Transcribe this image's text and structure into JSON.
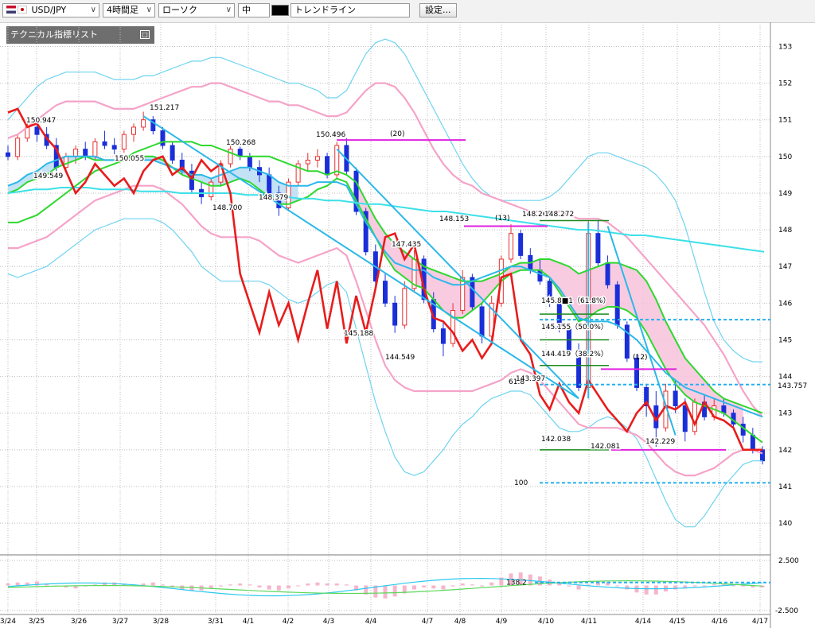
{
  "toolbar": {
    "pair": "USD/JPY",
    "timeframe": "4時間足",
    "chart_type": "ローソク",
    "line_width": "中",
    "tool": "トレンドライン",
    "settings": "設定..."
  },
  "indicator_panel": {
    "title": "テクニカル指標リスト"
  },
  "colors": {
    "candle_up": "#e83030",
    "candle_down": "#1a2fd8",
    "red_line": "#e81c1c",
    "green_line": "#2ed82e",
    "blue_line": "#2bb8e8",
    "cyan_line": "#3ce0e8",
    "bollinger": "#f5a3c8",
    "bollinger_outer": "#6fd3f0",
    "cloud_pink": "#f7c2dc",
    "cloud_blue": "#b9ddf5",
    "magenta": "#e020e0",
    "fib_green": "#1a8a1a",
    "dashed_blue": "#22b0ee"
  },
  "chart_data": {
    "type": "candlestick",
    "instrument": "USD/JPY",
    "y_range": [
      139.2,
      153.4
    ],
    "y_ticks": [
      153,
      152,
      151,
      150,
      149,
      148,
      147,
      146,
      145,
      144,
      143,
      142,
      141,
      140
    ],
    "x_dates": [
      "3/24",
      "3/25",
      "3/26",
      "3/27",
      "3/28",
      "3/31",
      "4/1",
      "4/2",
      "4/3",
      "4/4",
      "4/7",
      "4/8",
      "4/9",
      "4/10",
      "4/11",
      "4/14",
      "4/15",
      "4/16",
      "4/17"
    ],
    "price_labels": [
      {
        "text": "150.947",
        "value": 150.947
      },
      {
        "text": "149.549",
        "value": 149.549
      },
      {
        "text": "150.055",
        "value": 150.055
      },
      {
        "text": "151.217",
        "value": 151.217
      },
      {
        "text": "150.268",
        "value": 150.268
      },
      {
        "text": "148.700",
        "value": 148.7
      },
      {
        "text": "148.379",
        "value": 148.379
      },
      {
        "text": "150.496",
        "value": 150.496
      },
      {
        "text": "147.435",
        "value": 147.435
      },
      {
        "text": "145.188",
        "value": 145.188
      },
      {
        "text": "144.549",
        "value": 144.549
      },
      {
        "text": "148.153",
        "value": 148.153
      },
      {
        "text": "148.268",
        "value": 148.268
      },
      {
        "text": "148.272",
        "value": 148.272
      },
      {
        "text": "143.397",
        "value": 143.397
      },
      {
        "text": "142.038",
        "value": 142.038
      },
      {
        "text": "142.081",
        "value": 142.081
      },
      {
        "text": "142.229",
        "value": 142.229
      }
    ],
    "current_price": "143.757",
    "fib_labels": [
      "145.8■1（61.8%）",
      "145.155（50.0%）",
      "144.419（38.2%）"
    ],
    "fib_side_labels": [
      "61.8",
      "100"
    ],
    "count_labels": [
      "(20)",
      "(13)",
      "(12)"
    ],
    "macd_ticks": [
      "2.500",
      "-2.500"
    ],
    "macd_mid_label": "138.2",
    "candles": [
      [
        150.1,
        150.3,
        149.9,
        150.0
      ],
      [
        150.0,
        150.6,
        149.9,
        150.5
      ],
      [
        150.5,
        150.95,
        150.4,
        150.8
      ],
      [
        150.8,
        150.9,
        150.4,
        150.6
      ],
      [
        150.6,
        150.8,
        150.2,
        150.3
      ],
      [
        150.3,
        150.5,
        149.6,
        149.7
      ],
      [
        149.7,
        150.1,
        149.55,
        150.0
      ],
      [
        150.0,
        150.3,
        149.8,
        150.2
      ],
      [
        150.2,
        150.4,
        149.9,
        150.0
      ],
      [
        150.0,
        150.5,
        149.9,
        150.4
      ],
      [
        150.4,
        150.7,
        150.2,
        150.3
      ],
      [
        150.3,
        150.5,
        150.06,
        150.2
      ],
      [
        150.2,
        150.7,
        150.1,
        150.6
      ],
      [
        150.6,
        150.9,
        150.4,
        150.8
      ],
      [
        150.8,
        151.22,
        150.7,
        151.0
      ],
      [
        151.0,
        151.1,
        150.6,
        150.7
      ],
      [
        150.7,
        150.8,
        150.2,
        150.3
      ],
      [
        150.3,
        150.4,
        149.8,
        149.9
      ],
      [
        149.9,
        150.1,
        149.5,
        149.6
      ],
      [
        149.6,
        149.8,
        149.0,
        149.1
      ],
      [
        149.1,
        149.3,
        148.7,
        148.9
      ],
      [
        148.9,
        149.4,
        148.8,
        149.3
      ],
      [
        149.3,
        149.9,
        149.2,
        149.8
      ],
      [
        149.8,
        150.3,
        149.7,
        150.2
      ],
      [
        150.2,
        150.27,
        149.9,
        150.0
      ],
      [
        150.0,
        150.1,
        149.6,
        149.7
      ],
      [
        149.7,
        149.9,
        149.3,
        149.5
      ],
      [
        149.5,
        149.7,
        148.9,
        149.0
      ],
      [
        149.0,
        149.2,
        148.38,
        148.6
      ],
      [
        148.6,
        149.4,
        148.5,
        149.3
      ],
      [
        149.3,
        149.9,
        149.2,
        149.8
      ],
      [
        149.8,
        150.1,
        149.6,
        149.9
      ],
      [
        149.9,
        150.2,
        149.7,
        150.0
      ],
      [
        150.0,
        150.1,
        149.4,
        149.5
      ],
      [
        149.5,
        150.4,
        149.4,
        150.3
      ],
      [
        150.3,
        150.5,
        149.5,
        149.6
      ],
      [
        149.6,
        149.7,
        148.4,
        148.5
      ],
      [
        148.5,
        148.6,
        147.3,
        147.4
      ],
      [
        147.4,
        147.6,
        146.4,
        146.6
      ],
      [
        146.6,
        146.8,
        145.9,
        146.0
      ],
      [
        146.0,
        146.2,
        145.19,
        145.4
      ],
      [
        145.4,
        146.6,
        145.3,
        146.4
      ],
      [
        146.4,
        147.44,
        146.3,
        147.2
      ],
      [
        147.2,
        147.3,
        146.0,
        146.1
      ],
      [
        146.1,
        146.3,
        145.2,
        145.3
      ],
      [
        145.3,
        145.5,
        144.55,
        144.9
      ],
      [
        144.9,
        146.0,
        144.8,
        145.8
      ],
      [
        145.8,
        146.9,
        145.7,
        146.7
      ],
      [
        146.7,
        146.8,
        145.8,
        145.9
      ],
      [
        145.9,
        146.0,
        144.9,
        145.1
      ],
      [
        145.1,
        146.2,
        145.0,
        146.0
      ],
      [
        146.0,
        147.3,
        145.9,
        147.2
      ],
      [
        147.2,
        148.15,
        147.1,
        147.9
      ],
      [
        147.9,
        148.0,
        147.2,
        147.3
      ],
      [
        147.3,
        147.5,
        146.8,
        146.9
      ],
      [
        146.9,
        147.2,
        146.5,
        146.6
      ],
      [
        146.6,
        146.7,
        145.9,
        146.0
      ],
      [
        146.0,
        146.1,
        145.2,
        145.3
      ],
      [
        145.3,
        145.4,
        144.6,
        144.7
      ],
      [
        144.7,
        144.9,
        143.6,
        143.7
      ],
      [
        143.7,
        148.27,
        143.4,
        147.9
      ],
      [
        147.9,
        148.27,
        147.0,
        147.1
      ],
      [
        147.1,
        147.3,
        146.4,
        146.5
      ],
      [
        146.5,
        146.6,
        145.3,
        145.4
      ],
      [
        145.4,
        145.5,
        144.4,
        144.5
      ],
      [
        144.5,
        144.6,
        143.6,
        143.7
      ],
      [
        143.7,
        143.8,
        142.9,
        143.2
      ],
      [
        143.2,
        143.6,
        142.08,
        142.6
      ],
      [
        142.6,
        143.8,
        142.5,
        143.6
      ],
      [
        143.6,
        143.9,
        143.0,
        143.2
      ],
      [
        143.2,
        143.4,
        142.23,
        142.5
      ],
      [
        142.5,
        143.4,
        142.4,
        143.3
      ],
      [
        143.3,
        143.5,
        142.8,
        142.9
      ],
      [
        142.9,
        143.4,
        142.8,
        143.2
      ],
      [
        143.2,
        143.4,
        142.9,
        143.0
      ],
      [
        143.0,
        143.1,
        142.6,
        142.7
      ],
      [
        142.7,
        142.9,
        142.2,
        142.4
      ],
      [
        142.4,
        142.6,
        141.9,
        142.0
      ],
      [
        142.0,
        142.1,
        141.6,
        141.7
      ]
    ],
    "red_line": [
      151.2,
      151.3,
      150.8,
      150.9,
      150.5,
      150.2,
      149.6,
      149.0,
      149.3,
      149.8,
      149.5,
      149.2,
      149.4,
      149.0,
      149.6,
      149.9,
      150.0,
      149.5,
      149.7,
      149.4,
      149.9,
      149.6,
      149.8,
      149.0,
      146.8,
      146.0,
      145.2,
      146.3,
      145.4,
      146.0,
      145.0,
      146.0,
      146.9,
      145.3,
      146.6,
      144.9,
      146.2,
      145.2,
      146.4,
      147.8,
      147.9,
      147.2,
      147.6,
      146.4,
      145.6,
      145.5,
      145.2,
      144.7,
      145.0,
      144.5,
      144.9,
      146.7,
      146.8,
      145.0,
      144.6,
      143.5,
      143.1,
      143.8,
      143.3,
      143.0,
      143.9,
      143.5,
      143.1,
      142.8,
      142.5,
      143.0,
      143.3,
      142.8,
      143.2,
      143.1,
      143.3,
      142.7,
      143.3,
      142.9,
      142.8,
      142.6,
      142.0,
      142.0,
      142.0
    ],
    "green_fast": [
      149.0,
      149.1,
      149.3,
      149.4,
      149.5,
      149.7,
      149.8,
      149.9,
      150.0,
      149.9,
      149.9,
      149.9,
      149.9,
      150.0,
      150.0,
      150.0,
      149.9,
      149.7,
      149.5,
      149.4,
      149.3,
      149.2,
      149.2,
      149.3,
      149.4,
      149.3,
      149.1,
      148.9,
      148.7,
      148.7,
      148.8,
      148.9,
      149.1,
      149.2,
      149.4,
      149.3,
      148.8,
      148.3,
      147.8,
      147.3,
      146.9,
      146.7,
      146.5,
      146.4,
      146.1,
      145.8,
      145.6,
      145.6,
      145.8,
      146.0,
      146.3,
      146.6,
      146.8,
      146.9,
      146.9,
      146.9,
      146.7,
      146.3,
      145.9,
      145.5,
      145.6,
      145.8,
      145.9,
      145.9,
      145.8,
      145.6,
      145.2,
      144.7,
      144.2,
      143.8,
      143.5,
      143.3,
      143.2,
      143.1,
      143.0,
      142.8,
      142.6,
      142.4,
      142.2
    ],
    "green_slow": [
      148.2,
      148.2,
      148.3,
      148.4,
      148.6,
      148.8,
      149.0,
      149.2,
      149.4,
      149.6,
      149.7,
      149.8,
      149.9,
      150.1,
      150.2,
      150.3,
      150.4,
      150.4,
      150.4,
      150.4,
      150.3,
      150.3,
      150.2,
      150.1,
      150.0,
      150.0,
      150.0,
      150.0,
      149.9,
      149.8,
      149.7,
      149.6,
      149.6,
      149.5,
      149.6,
      149.5,
      149.3,
      148.8,
      148.3,
      147.9,
      147.6,
      147.4,
      147.2,
      147.0,
      146.9,
      146.8,
      146.7,
      146.6,
      146.6,
      146.6,
      146.7,
      146.8,
      147.0,
      147.1,
      147.1,
      147.2,
      147.2,
      147.1,
      147.0,
      146.8,
      146.9,
      147.0,
      147.1,
      147.1,
      147.0,
      146.9,
      146.6,
      146.1,
      145.5,
      145.0,
      144.5,
      144.2,
      143.9,
      143.6,
      143.4,
      143.3,
      143.2,
      143.1,
      143.0
    ],
    "blue_line": [
      149.2,
      149.3,
      149.5,
      149.6,
      149.8,
      149.9,
      150.0,
      150.0,
      150.0,
      150.0,
      149.9,
      149.9,
      149.9,
      149.9,
      149.9,
      149.9,
      149.8,
      149.7,
      149.6,
      149.5,
      149.5,
      149.4,
      149.5,
      149.6,
      149.7,
      149.7,
      149.6,
      149.5,
      149.3,
      149.2,
      149.2,
      149.2,
      149.3,
      149.3,
      149.3,
      149.2,
      148.7,
      148.2,
      147.8,
      147.4,
      147.1,
      147.0,
      146.9,
      146.9,
      146.7,
      146.6,
      146.5,
      146.5,
      146.6,
      146.7,
      146.8,
      146.9,
      147.0,
      147.0,
      146.9,
      146.8,
      146.7,
      146.4,
      146.0,
      145.6,
      145.5,
      145.5,
      145.5,
      145.4,
      145.2,
      145.0,
      144.7,
      144.4,
      144.1,
      143.9,
      143.7,
      143.6,
      143.5,
      143.4,
      143.3,
      143.2,
      143.1,
      143.0,
      142.9
    ],
    "boll_upper": [
      150.5,
      150.6,
      150.8,
      151.0,
      151.2,
      151.4,
      151.5,
      151.5,
      151.5,
      151.5,
      151.4,
      151.3,
      151.3,
      151.3,
      151.4,
      151.5,
      151.6,
      151.7,
      151.8,
      151.9,
      151.9,
      152.0,
      152.0,
      151.9,
      151.8,
      151.7,
      151.6,
      151.5,
      151.5,
      151.4,
      151.4,
      151.3,
      151.2,
      151.1,
      151.1,
      151.2,
      151.5,
      151.8,
      152.0,
      152.0,
      151.9,
      151.6,
      151.2,
      150.7,
      150.2,
      149.8,
      149.5,
      149.3,
      149.2,
      149.0,
      148.9,
      148.8,
      148.7,
      148.6,
      148.5,
      148.5,
      148.5,
      148.5,
      148.4,
      148.3,
      148.3,
      148.3,
      148.2,
      148.0,
      147.8,
      147.5,
      147.2,
      146.9,
      146.6,
      146.3,
      146.0,
      145.7,
      145.4,
      145.0,
      144.6,
      144.1,
      143.6,
      143.2,
      142.9
    ],
    "boll_lower": [
      147.5,
      147.5,
      147.6,
      147.7,
      147.8,
      148.0,
      148.2,
      148.4,
      148.6,
      148.8,
      148.9,
      149.0,
      149.1,
      149.2,
      149.2,
      149.2,
      149.1,
      148.9,
      148.7,
      148.4,
      148.1,
      147.9,
      147.8,
      147.8,
      147.8,
      147.8,
      147.7,
      147.5,
      147.3,
      147.2,
      147.1,
      147.2,
      147.3,
      147.4,
      147.5,
      147.3,
      146.6,
      145.8,
      145.0,
      144.3,
      143.9,
      143.7,
      143.6,
      143.6,
      143.6,
      143.6,
      143.6,
      143.6,
      143.6,
      143.7,
      143.8,
      143.9,
      144.1,
      144.2,
      144.1,
      143.9,
      143.6,
      143.3,
      143.0,
      142.7,
      142.6,
      142.6,
      142.6,
      142.6,
      142.5,
      142.4,
      142.2,
      141.9,
      141.6,
      141.4,
      141.3,
      141.3,
      141.4,
      141.5,
      141.7,
      141.9,
      142.0,
      142.0,
      141.9
    ],
    "boll_outer_upper": [
      151.0,
      151.3,
      151.6,
      151.9,
      152.1,
      152.2,
      152.3,
      152.3,
      152.3,
      152.3,
      152.2,
      152.1,
      152.1,
      152.1,
      152.2,
      152.2,
      152.3,
      152.4,
      152.5,
      152.6,
      152.6,
      152.7,
      152.7,
      152.6,
      152.5,
      152.4,
      152.3,
      152.2,
      152.1,
      152.0,
      152.0,
      151.9,
      151.8,
      151.6,
      151.6,
      151.8,
      152.3,
      152.8,
      153.1,
      153.2,
      153.1,
      152.8,
      152.3,
      151.8,
      151.3,
      150.8,
      150.3,
      149.8,
      149.4,
      149.1,
      148.9,
      148.8,
      148.8,
      148.8,
      148.8,
      148.8,
      148.9,
      149.1,
      149.4,
      149.7,
      150.0,
      150.1,
      150.1,
      150.0,
      149.9,
      149.8,
      149.7,
      149.5,
      149.2,
      148.8,
      148.1,
      147.2,
      146.3,
      145.5,
      145.0,
      144.7,
      144.5,
      144.4,
      144.4
    ],
    "boll_outer_lower": [
      146.8,
      146.7,
      146.8,
      146.9,
      147.0,
      147.2,
      147.4,
      147.6,
      147.8,
      148.0,
      148.1,
      148.2,
      148.3,
      148.3,
      148.3,
      148.3,
      148.2,
      148.0,
      147.7,
      147.4,
      147.0,
      146.8,
      146.6,
      146.6,
      146.6,
      146.6,
      146.6,
      146.5,
      146.3,
      146.1,
      146.0,
      146.1,
      146.3,
      146.5,
      146.6,
      146.3,
      145.3,
      144.3,
      143.3,
      142.5,
      141.8,
      141.4,
      141.3,
      141.4,
      141.7,
      142.0,
      142.4,
      142.7,
      142.9,
      143.2,
      143.4,
      143.5,
      143.6,
      143.6,
      143.5,
      143.2,
      142.9,
      142.6,
      142.5,
      142.5,
      142.6,
      142.8,
      142.9,
      142.8,
      142.6,
      142.3,
      141.8,
      141.2,
      140.6,
      140.1,
      139.9,
      139.9,
      140.2,
      140.6,
      141.0,
      141.3,
      141.6,
      141.7,
      141.7
    ],
    "cyan_long": [
      149.0,
      149.05,
      149.1,
      149.1,
      149.15,
      149.15,
      149.15,
      149.1,
      149.1,
      149.1,
      149.05,
      149.05,
      149.05,
      149.0,
      149.0,
      149.0,
      149.0,
      149.0,
      148.95,
      148.95,
      148.9,
      148.9,
      148.85,
      148.85,
      148.8,
      148.8,
      148.75,
      148.7,
      148.7,
      148.65,
      148.6,
      148.55,
      148.5,
      148.5,
      148.45,
      148.4,
      148.35,
      148.3,
      148.25,
      148.2,
      148.15,
      148.1,
      148.05,
      148.0,
      148.0,
      147.95,
      147.9,
      147.85,
      147.85,
      147.8,
      147.75,
      147.7,
      147.65,
      147.6,
      147.55,
      147.5,
      147.45,
      147.4
    ]
  }
}
